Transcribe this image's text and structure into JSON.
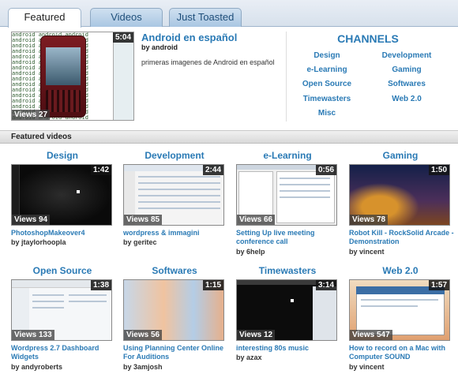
{
  "tabs": [
    {
      "label": "Featured",
      "active": true
    },
    {
      "label": "Videos",
      "active": false
    },
    {
      "label": "Just Toasted",
      "active": false
    }
  ],
  "featured": {
    "title": "Android en español",
    "by_prefix": "by",
    "author": "android",
    "description": "primeras imagenes de Android en español",
    "duration": "5:04",
    "views": "Views 27"
  },
  "channels": {
    "title": "CHANNELS",
    "items": [
      "Design",
      "Development",
      "e-Learning",
      "Gaming",
      "Open Source",
      "Softwares",
      "Timewasters",
      "Web 2.0",
      "Misc"
    ]
  },
  "section_title": "Featured videos",
  "videos": [
    {
      "category": "Design",
      "duration": "1:42",
      "views": "Views 94",
      "title": "PhotoshopMakeover4",
      "by": "by",
      "author": "jtaylorhoopla"
    },
    {
      "category": "Development",
      "duration": "2:44",
      "views": "Views 85",
      "title": "wordpress & immagini",
      "by": "by",
      "author": "geritec"
    },
    {
      "category": "e-Learning",
      "duration": "0:56",
      "views": "Views 66",
      "title": "Setting Up live meeting conference call",
      "by": "by",
      "author": "6help"
    },
    {
      "category": "Gaming",
      "duration": "1:50",
      "views": "Views 78",
      "title": "Robot Kill - RockSolid Arcade - Demonstration",
      "by": "by",
      "author": "vincent"
    },
    {
      "category": "Open Source",
      "duration": "1:38",
      "views": "Views 133",
      "title": "Wordpress 2.7 Dashboard Widgets",
      "by": "by",
      "author": "andyroberts"
    },
    {
      "category": "Softwares",
      "duration": "1:15",
      "views": "Views 56",
      "title": "Using Planning Center Online For Auditions",
      "by": "by",
      "author": "3amjosh"
    },
    {
      "category": "Timewasters",
      "duration": "3:14",
      "views": "Views 12",
      "title": "interesting 80s music",
      "by": "by",
      "author": "azax"
    },
    {
      "category": "Web 2.0",
      "duration": "1:57",
      "views": "Views 547",
      "title": "How to record on a Mac with Computer SOUND",
      "by": "by",
      "author": "vincent"
    }
  ],
  "colors": {
    "link": "#2a7ab5",
    "tab_bg": "#a9c6e2"
  }
}
